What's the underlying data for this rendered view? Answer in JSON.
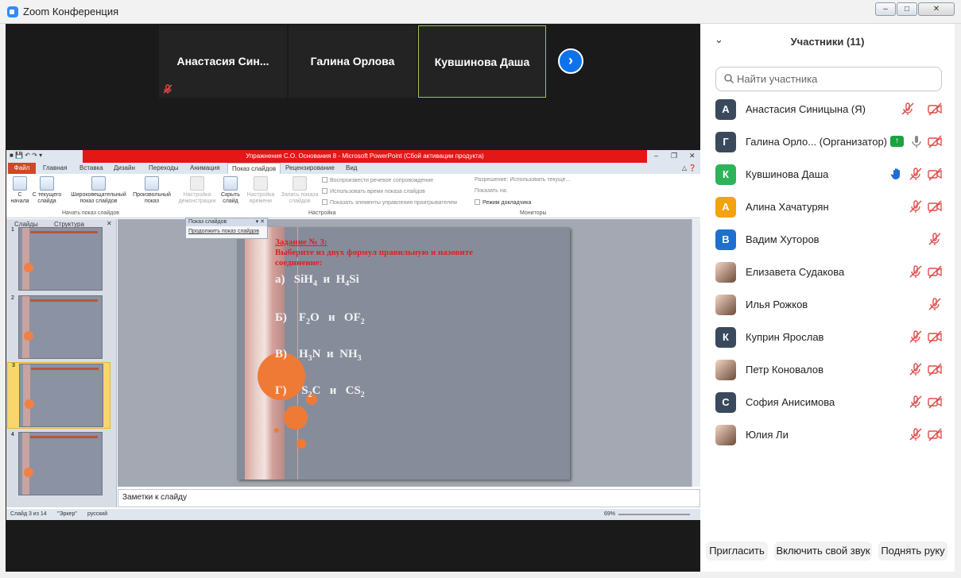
{
  "window": {
    "title": "Zoom Конференция"
  },
  "videos": {
    "tiles": [
      {
        "name": "Анастасия  Син..."
      },
      {
        "name": "Галина Орлова"
      },
      {
        "name": "Кувшинова Даша"
      }
    ]
  },
  "ppt": {
    "title": "Упражнения С.О. Основания 8  -  Microsoft PowerPoint (Сбой активации продукта)",
    "tabs": [
      "Файл",
      "Главная",
      "Вставка",
      "Дизайн",
      "Переходы",
      "Анимация",
      "Показ слайдов",
      "Рецензирование",
      "Вид"
    ],
    "ribbon": {
      "from_start": "С начала",
      "from_current": "С текущего слайда",
      "broadcast": "Широковещательный показ слайдов",
      "custom": "Произвольный показ",
      "setup": "Настройка демонстрации",
      "hide": "Скрыть слайд",
      "rehearse": "Настройка времени",
      "record": "Запись показа слайдов",
      "check_narration": "Воспроизвести речевое сопровождение",
      "check_timing": "Использовать время показа слайдов",
      "check_controls": "Показать элементы управления проигрывателем",
      "resolution_label": "Разрешение:",
      "resolution_value": "Использовать текуще...",
      "show_on_label": "Показать на:",
      "presenter_view": "Режим докладчика",
      "group_start": "Начать показ слайдов",
      "group_setup": "Настройка",
      "group_monitors": "Мониторы"
    },
    "panel_tabs": {
      "slides": "Слайды",
      "structure": "Структура"
    },
    "popup": {
      "title": "Показ слайдов",
      "action": "Продолжить показ слайдов"
    },
    "thumb_numbers": [
      "1",
      "2",
      "3",
      "4"
    ],
    "slide": {
      "task": "Задание № 3:",
      "instruction1": "Выберите из двух формул правильную и назовите",
      "instruction2": "соединение:",
      "a": "а)",
      "b": "Б)",
      "v": "В)",
      "g": "Г)"
    },
    "notes_placeholder": "Заметки к слайду",
    "status": {
      "slide": "Слайд 3 из 14",
      "theme": "\"Эркер\"",
      "lang": "русский",
      "zoom": "69%"
    }
  },
  "participants_panel": {
    "title": "Участники (11)",
    "search_placeholder": "Найти участника",
    "participants": [
      {
        "initial": "А",
        "name": "Анастасия Синицына (Я)",
        "color": "#3a4a5c"
      },
      {
        "initial": "Г",
        "name": "Галина Орло... (Организатор)",
        "color": "#3a4a5c"
      },
      {
        "initial": "К",
        "name": "Кувшинова Даша",
        "color": "#2fb35a"
      },
      {
        "initial": "А",
        "name": "Алина Хачатурян",
        "color": "#f2a30f"
      },
      {
        "initial": "В",
        "name": "Вадим Хуторов",
        "color": "#1f6fd0"
      },
      {
        "initial": "",
        "name": "Елизавета Судакова",
        "color": ""
      },
      {
        "initial": "",
        "name": "Илья Рожков",
        "color": ""
      },
      {
        "initial": "К",
        "name": "Куприн Ярослав",
        "color": "#3a4a5c"
      },
      {
        "initial": "",
        "name": "Петр Коновалов",
        "color": ""
      },
      {
        "initial": "С",
        "name": "София Анисимова",
        "color": "#3a4a5c"
      },
      {
        "initial": "",
        "name": "Юлия Ли",
        "color": ""
      }
    ],
    "buttons": {
      "invite": "Пригласить",
      "unmute": "Включить свой звук",
      "raise_hand": "Поднять руку"
    }
  }
}
